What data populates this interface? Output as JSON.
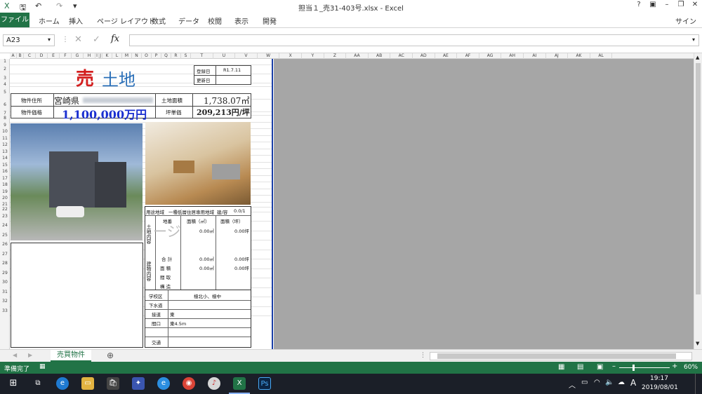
{
  "window": {
    "title": "担当１_売31-403号.xlsx - Excel",
    "help": "?",
    "sign_in": "サインイン"
  },
  "ribbon": {
    "tabs": [
      "ファイル",
      "ホーム",
      "挿入",
      "ページ レイアウト",
      "数式",
      "データ",
      "校閲",
      "表示",
      "開発"
    ]
  },
  "formula_bar": {
    "name_box": "A23",
    "fx": "fx",
    "value": ""
  },
  "columns": [
    "A",
    "B",
    "C",
    "D",
    "E",
    "F",
    "G",
    "H",
    "I",
    "J",
    "K",
    "L",
    "M",
    "N",
    "O",
    "P",
    "Q",
    "R",
    "S",
    "T",
    "U",
    "V",
    "W",
    "X",
    "Y",
    "Z",
    "AA",
    "AB",
    "AC",
    "AD",
    "AE",
    "AF",
    "AG",
    "AH",
    "AI",
    "AJ",
    "AK",
    "AL"
  ],
  "rows": [
    "1",
    "2",
    "3",
    "4",
    "5",
    "6",
    "7",
    "8",
    "9",
    "10",
    "11",
    "12",
    "13",
    "14",
    "15",
    "16",
    "17",
    "18",
    "19",
    "20",
    "21",
    "22",
    "23",
    "24",
    "25",
    "26",
    "27",
    "28",
    "29",
    "30",
    "31",
    "32",
    "33"
  ],
  "flyer": {
    "sale_mark": "売",
    "category": "土地",
    "registered_label": "登録日",
    "registered_value": "R1.7.11",
    "updated_label": "更新日",
    "updated_value": "",
    "address_label": "物件住所",
    "address_prefix": "宮崎県",
    "price_label": "物件価格",
    "price_value": "1,100,000万円",
    "land_area_label": "土地面積",
    "land_area_value": "1,738.07㎡",
    "unit_price_label": "坪単価",
    "unit_price_value": "209,213円/坪",
    "zoning_label": "用途地域",
    "zoning_value": "一種低層住居専用地域",
    "ratio_label": "建/容",
    "ratio_value": "0.0/1",
    "land_section_label": "土地内容",
    "lot_no_label": "地番",
    "area_sqm_label": "面積（㎡）",
    "area_tsubo_label": "面積（坪）",
    "row1_sqm": "0.00㎡",
    "row1_tsubo": "0.00坪",
    "total_label": "合 計",
    "total_sqm": "0.00㎡",
    "total_tsubo": "0.00坪",
    "building_section_label": "建物内容",
    "bldg_area_label": "面 積",
    "bldg_area_sqm": "0.00㎡",
    "bldg_area_tsubo": "0.00坪",
    "layout_label": "間 取",
    "structure_label": "構 造",
    "school_label": "学校区",
    "school_value": "檍北小、檍中",
    "sewer_label": "下水道",
    "road_label": "接道",
    "road_value": "東",
    "frontage_label": "間口",
    "frontage_value": "東4.5m",
    "traffic_label": "交通",
    "watermark": "ージ"
  },
  "sheet": {
    "tab_name": "売買物件",
    "add_icon": "⊕"
  },
  "status": {
    "ready": "準備完了",
    "zoom": "60%"
  },
  "taskbar": {
    "time": "19:17",
    "date": "2019/08/01",
    "ime": "A"
  }
}
